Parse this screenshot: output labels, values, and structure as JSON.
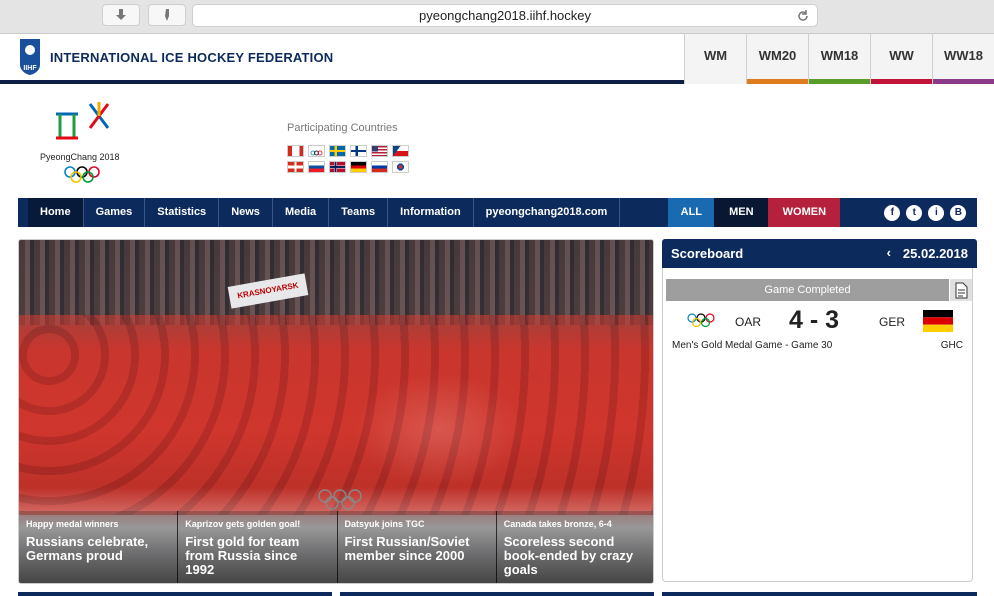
{
  "browser": {
    "url": "pyeongchang2018.iihf.hockey"
  },
  "iihf": {
    "title": "INTERNATIONAL ICE HOCKEY FEDERATION",
    "logo_text": "IIHF",
    "tabs": [
      {
        "label": "WM",
        "color": ""
      },
      {
        "label": "WM20",
        "color": "#e07a1f"
      },
      {
        "label": "WM18",
        "color": "#5a9c2a"
      },
      {
        "label": "WW",
        "color": "#c2143b"
      },
      {
        "label": "WW18",
        "color": "#8a3c8a"
      }
    ]
  },
  "event": {
    "logo_text": "PyeongChang 2018",
    "participating_label": "Participating Countries"
  },
  "nav": {
    "items": [
      "Home",
      "Games",
      "Statistics",
      "News",
      "Media",
      "Teams",
      "Information",
      "pyeongchang2018.com"
    ],
    "filters": {
      "all": "ALL",
      "men": "MEN",
      "women": "WOMEN"
    },
    "social": [
      "f",
      "t",
      "i",
      "B"
    ]
  },
  "hero": {
    "banner_text": "KRASNOYARSK",
    "captions": [
      {
        "small": "Happy medal winners",
        "large": "Russians celebrate, Germans proud"
      },
      {
        "small": "Kaprizov gets golden goal!",
        "large": "First gold for team from Russia since 1992"
      },
      {
        "small": "Datsyuk joins TGC",
        "large": "First Russian/Soviet member since 2000"
      },
      {
        "small": "Canada takes bronze, 6-4",
        "large": "Scoreless second book-ended by crazy goals"
      }
    ]
  },
  "scoreboard": {
    "title": "Scoreboard",
    "prev_symbol": "‹",
    "date": "25.02.2018",
    "status": "Game Completed",
    "team1": "OAR",
    "score": "4 - 3",
    "team2": "GER",
    "game": "Men's Gold Medal Game - Game 30",
    "venue": "GHC"
  },
  "colors": {
    "navy": "#0d2a5c",
    "all": "#1a6ab1",
    "women": "#b5213d"
  }
}
